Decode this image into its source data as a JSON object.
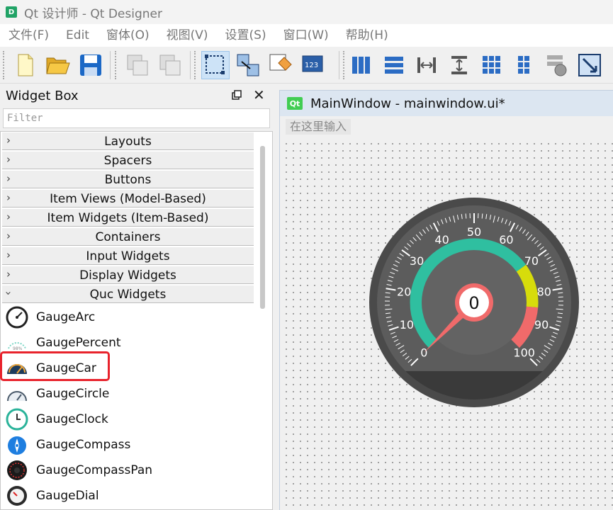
{
  "window": {
    "title": "Qt 设计师 - Qt Designer",
    "logo": "D"
  },
  "menubar": [
    "文件(F)",
    "Edit",
    "窗体(O)",
    "视图(V)",
    "设置(S)",
    "窗口(W)",
    "帮助(H)"
  ],
  "toolbar": {
    "icons": [
      "new-file-icon",
      "open-folder-icon",
      "save-icon",
      "cut-icon",
      "paste-icon",
      "edit-widgets-icon",
      "edit-signals-slots-icon",
      "edit-buddies-icon",
      "edit-tab-order-icon",
      "layout-horizontal-icon",
      "layout-vertical-icon",
      "layout-horizontal-splitter-icon",
      "layout-vertical-splitter-icon",
      "layout-grid-icon",
      "layout-form-icon",
      "break-layout-icon",
      "adjust-size-icon"
    ]
  },
  "widget_box": {
    "title": "Widget Box",
    "filter_placeholder": "Filter",
    "categories": [
      {
        "label": "Layouts",
        "expanded": false
      },
      {
        "label": "Spacers",
        "expanded": false
      },
      {
        "label": "Buttons",
        "expanded": false
      },
      {
        "label": "Item Views (Model-Based)",
        "expanded": false
      },
      {
        "label": "Item Widgets (Item-Based)",
        "expanded": false
      },
      {
        "label": "Containers",
        "expanded": false
      },
      {
        "label": "Input Widgets",
        "expanded": false
      },
      {
        "label": "Display Widgets",
        "expanded": false
      },
      {
        "label": "Quc Widgets",
        "expanded": true
      }
    ],
    "items": [
      {
        "label": "GaugeArc",
        "icon": "gauge-arc-icon"
      },
      {
        "label": "GaugePercent",
        "icon": "gauge-percent-icon"
      },
      {
        "label": "GaugeCar",
        "icon": "gauge-car-icon",
        "highlighted": true
      },
      {
        "label": "GaugeCircle",
        "icon": "gauge-circle-icon"
      },
      {
        "label": "GaugeClock",
        "icon": "gauge-clock-icon"
      },
      {
        "label": "GaugeCompass",
        "icon": "gauge-compass-icon"
      },
      {
        "label": "GaugeCompassPan",
        "icon": "gauge-compass-pan-icon"
      },
      {
        "label": "GaugeDial",
        "icon": "gauge-dial-icon"
      }
    ]
  },
  "subwindow": {
    "logo": "Qt",
    "title": "MainWindow - mainwindow.ui*",
    "menu_placeholder": "在这里输入"
  },
  "gauge": {
    "value": "0",
    "min": 0,
    "max": 100,
    "scale_labels": [
      "0",
      "10",
      "20",
      "30",
      "40",
      "50",
      "60",
      "70",
      "80",
      "90",
      "100"
    ],
    "colors": {
      "outer": "#4a4a4a",
      "face": "#5e5e5e",
      "green": "#2fbfa0",
      "yellow": "#d7dc0b",
      "red": "#f06a6a",
      "center_ring": "#f06a6a"
    }
  }
}
